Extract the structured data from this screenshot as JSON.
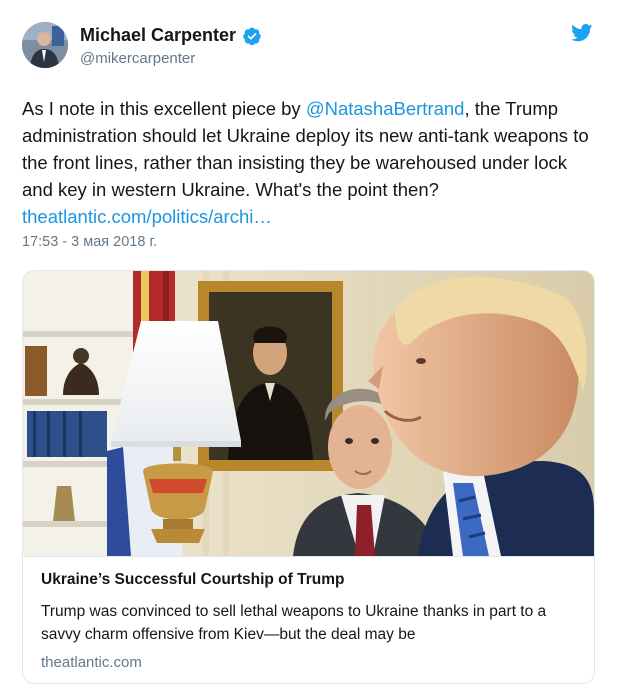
{
  "author": {
    "name": "Michael Carpenter",
    "handle": "@mikercarpenter",
    "verified": true,
    "avatar_icon": "avatar-photo"
  },
  "tweet": {
    "text_before_mention": "As I note in this excellent piece by ",
    "mention": "@NatashaBertrand",
    "text_after_mention": ", the Trump administration should let Ukraine deploy its new anti-tank weapons to the front lines, rather than insisting they be warehoused under lock and key in western Ukraine. What's the point then? ",
    "link": "theatlantic.com/politics/archi…",
    "timestamp": "17:53 - 3 мая 2018 г."
  },
  "card": {
    "title": "Ukraine’s Successful Courtship of Trump",
    "description": "Trump was convinced to sell lethal weapons to Ukraine thanks in part to a savvy charm offensive from Kiev—but the deal may be",
    "domain": "theatlantic.com",
    "image_icon": "photo-oval-office"
  },
  "colors": {
    "link": "#1b95e0",
    "text": "#14171a",
    "muted": "#657786",
    "border": "#e1e8ed",
    "twitter_blue": "#1da1f2"
  },
  "icons": [
    "twitter-bird-icon",
    "verified-badge-icon"
  ]
}
